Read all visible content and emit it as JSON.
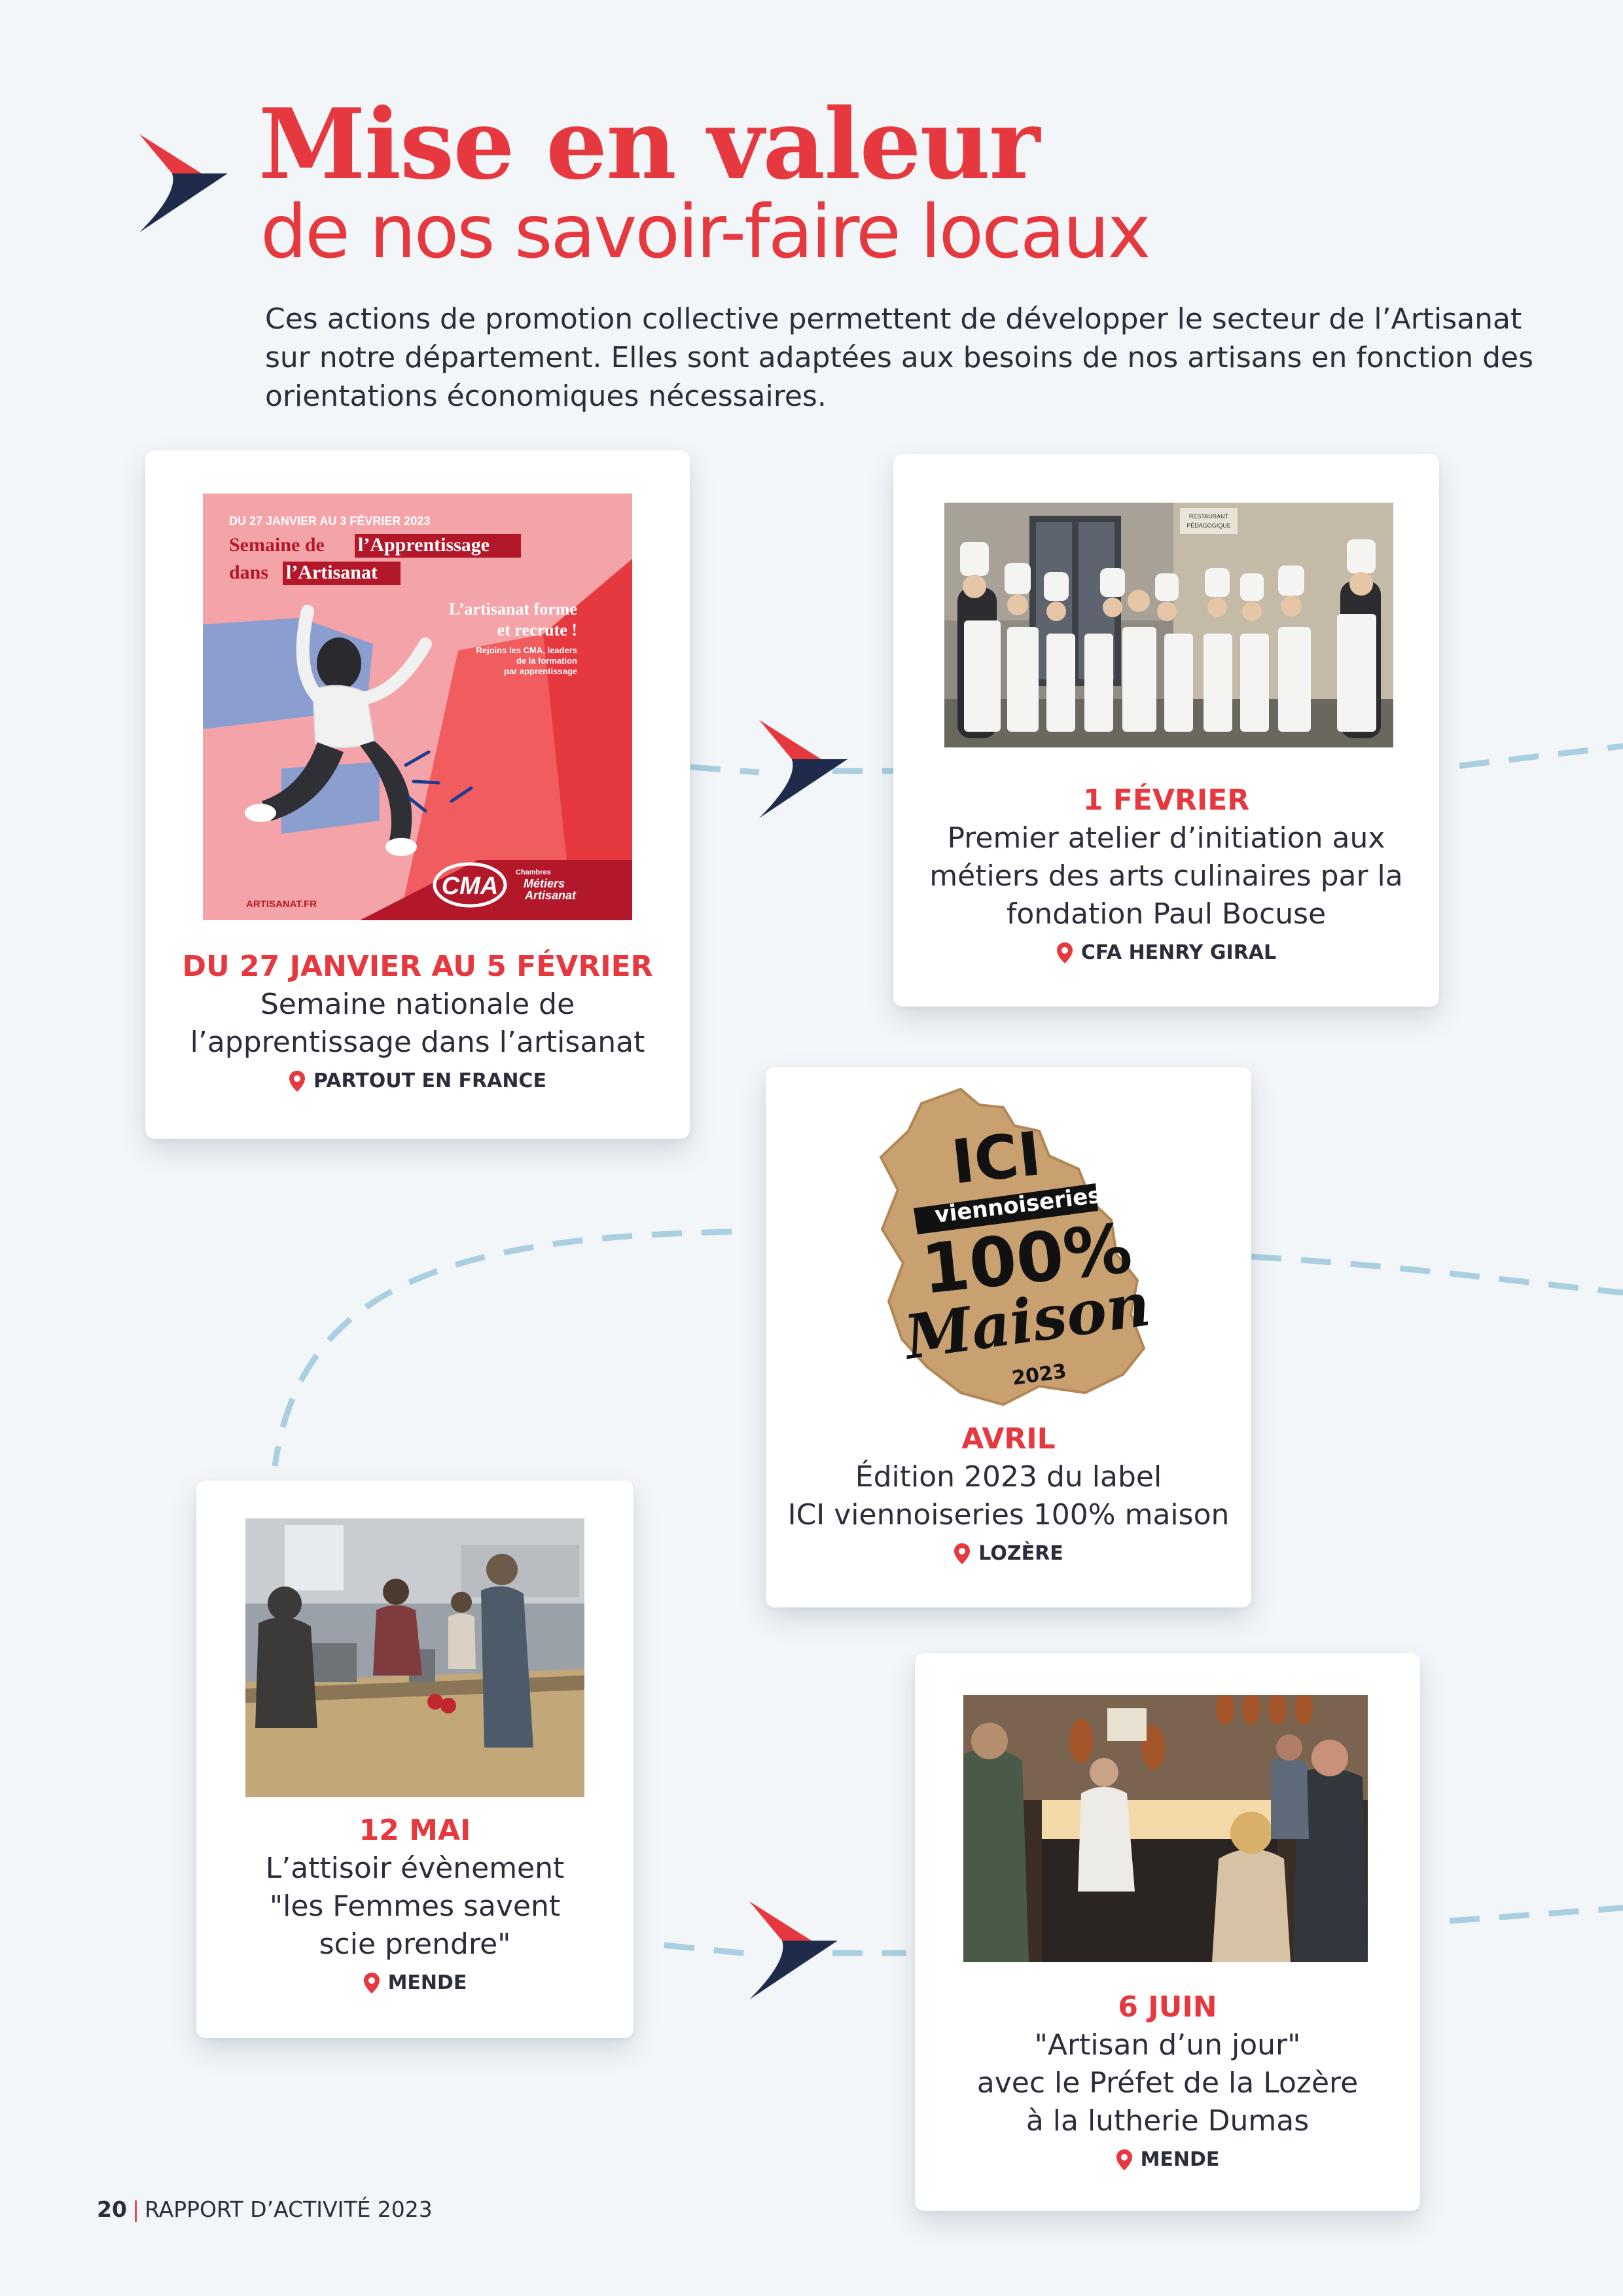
{
  "header": {
    "title": "Mise en valeur",
    "subtitle": "de nos savoir-faire locaux",
    "intro": "Ces actions de promotion collective permettent de développer le secteur de l’Artisanat sur notre département. Elles sont adaptées aux besoins de nos artisans en fonction des orientations économiques nécessaires."
  },
  "colors": {
    "accent": "#e5393f",
    "navy": "#1f2b4a",
    "connector": "#a9cfe0",
    "text": "#2b2d3a"
  },
  "poster": {
    "dates": "DU 27 JANVIER AU 3 FÉVRIER 2023",
    "title_line1_a": "Semaine de",
    "title_line1_b": "l’Apprentissage",
    "title_line2_a": "dans",
    "title_line2_b": "l’Artisanat",
    "slogan_line1": "L’artisanat forme",
    "slogan_line2": "et recrute !",
    "note_line1": "Rejoins les CMA, leaders",
    "note_line2": "de la formation",
    "note_line3": "par apprentissage",
    "site": "ARTISANAT.FR",
    "brand_logo": "CMA",
    "brand_line1": "Chambres",
    "brand_line2": "Métiers",
    "brand_line3": "Artisanat"
  },
  "events": [
    {
      "date": "DU 27 JANVIER AU 5 FÉVRIER",
      "description_lines": [
        "Semaine nationale de",
        "l’apprentissage dans l’artisanat"
      ],
      "location": "PARTOUT EN FRANCE"
    },
    {
      "date": "1 FÉVRIER",
      "description_lines": [
        "Premier atelier d’initiation aux",
        "métiers des arts culinaires par la",
        "fondation Paul Bocuse"
      ],
      "location": "CFA HENRY GIRAL",
      "photo_sign_line1": "RESTAURANT",
      "photo_sign_line2": "PÉDAGOGIQUE"
    },
    {
      "date": "AVRIL",
      "description_lines": [
        "Édition 2023 du label",
        "ICI viennoiseries 100% maison"
      ],
      "location": "LOZÈRE",
      "label_logo": {
        "ici": "ICI",
        "ribbon": "viennoiseries",
        "percent": "100%",
        "maison": "Maison",
        "year": "2023"
      }
    },
    {
      "date": "12 MAI",
      "description_lines": [
        "L’attisoir évènement",
        "\"les Femmes savent",
        "scie prendre\""
      ],
      "location": "MENDE"
    },
    {
      "date": "6 JUIN",
      "description_lines": [
        "\"Artisan d’un jour\"",
        "avec le Préfet de la Lozère",
        "à la lutherie Dumas"
      ],
      "location": "MENDE"
    }
  ],
  "footer": {
    "page_number": "20",
    "report_title": "RAPPORT D’ACTIVITÉ 2023"
  }
}
